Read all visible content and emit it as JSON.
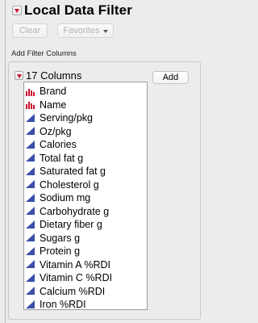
{
  "header": {
    "title": "Local Data Filter",
    "clear_label": "Clear",
    "favorites_label": "Favorites"
  },
  "filter_columns": {
    "section_label": "Add Filter Columns",
    "columns_count_label": "17 Columns",
    "add_label": "Add",
    "items": [
      {
        "label": "Brand",
        "icon": "nominal-bar-icon"
      },
      {
        "label": "Name",
        "icon": "nominal-bar-icon"
      },
      {
        "label": "Serving/pkg",
        "icon": "continuous-triangle-icon"
      },
      {
        "label": "Oz/pkg",
        "icon": "continuous-triangle-icon"
      },
      {
        "label": "Calories",
        "icon": "continuous-triangle-icon"
      },
      {
        "label": "Total fat g",
        "icon": "continuous-triangle-icon"
      },
      {
        "label": "Saturated fat g",
        "icon": "continuous-triangle-icon"
      },
      {
        "label": "Cholesterol g",
        "icon": "continuous-triangle-icon"
      },
      {
        "label": "Sodium mg",
        "icon": "continuous-triangle-icon"
      },
      {
        "label": "Carbohydrate g",
        "icon": "continuous-triangle-icon"
      },
      {
        "label": "Dietary fiber g",
        "icon": "continuous-triangle-icon"
      },
      {
        "label": "Sugars g",
        "icon": "continuous-triangle-icon"
      },
      {
        "label": "Protein g",
        "icon": "continuous-triangle-icon"
      },
      {
        "label": "Vitamin A %RDI",
        "icon": "continuous-triangle-icon"
      },
      {
        "label": "Vitamin C %RDI",
        "icon": "continuous-triangle-icon"
      },
      {
        "label": "Calcium %RDI",
        "icon": "continuous-triangle-icon"
      },
      {
        "label": "Iron %RDI",
        "icon": "continuous-triangle-icon"
      }
    ]
  },
  "colors": {
    "nominal_icon": "#c8102e",
    "continuous_icon": "#3b4fa8",
    "disclosure_triangle": "#c8102e"
  }
}
